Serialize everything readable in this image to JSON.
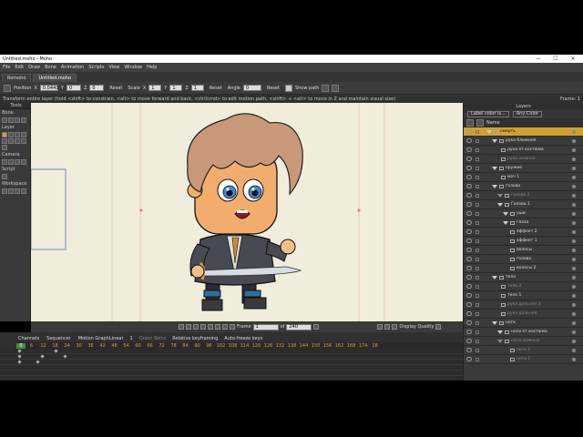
{
  "window": {
    "title": "Untitled.moho - Moho",
    "min": "—",
    "max": "☐",
    "close": "✕"
  },
  "menu": [
    "File",
    "Edit",
    "Draw",
    "Bone",
    "Animation",
    "Scripts",
    "View",
    "Window",
    "Help"
  ],
  "doctabs": [
    "Romoho",
    "Untitled.moho"
  ],
  "options": {
    "position_label": "Position",
    "x_label": "X",
    "x_value": "0.0440",
    "y_label": "Y",
    "y_value": "0",
    "z_label": "Z",
    "z_value": "0",
    "reset1": "Reset",
    "scale_label": "Scale",
    "scale_x_label": "X",
    "scale_x_value": "1",
    "scale_y_label": "Y",
    "scale_y_value": "1",
    "scale_z_label": "Z",
    "scale_z_value": "1",
    "reset2": "Reset",
    "angle_label": "Angle",
    "angle_value": "0",
    "reset3": "Reset",
    "show_path": "Show path"
  },
  "status": {
    "hint": "Transform entire layer (hold <shift> to constrain, <alt> to move forward and back, <ctrl/cmd> to edit motion path, <shift> + <alt> to move in Z and maintain visual size)",
    "frame": "Frame: 1"
  },
  "tools": {
    "header": "Tools",
    "bone": "Bone",
    "layer": "Layer",
    "camera": "Camera",
    "script": "Script",
    "workspace": "Workspace"
  },
  "playback": {
    "frame_label": "Frame",
    "frame_value": "1",
    "of_label": "of",
    "of_value": "240",
    "display_quality": "Display Quality"
  },
  "timeline": {
    "tabs": [
      "Channels",
      "Sequencer",
      "Motion Graph"
    ],
    "interp": "Linear",
    "interp_num": "1",
    "onion": "Onion Skins",
    "relative": "Relative keyframing",
    "autofreeze": "Auto-freeze keys",
    "ruler": [
      "6",
      "12",
      "18",
      "24",
      "30",
      "36",
      "42",
      "48",
      "54",
      "60",
      "66",
      "72",
      "78",
      "84",
      "90",
      "96",
      "102",
      "108",
      "114",
      "120",
      "126",
      "132",
      "138",
      "144",
      "150",
      "156",
      "162",
      "168",
      "174",
      "18"
    ],
    "ruler_first": "0"
  },
  "layers": {
    "header": "Layers",
    "filter1": "Label color is...",
    "filter2": "Any Color",
    "col_name": "Name",
    "rows": [
      {
        "name": "смерть",
        "sel": true,
        "indent": 0
      },
      {
        "name": "рука ближняя",
        "indent": 1
      },
      {
        "name": "рука от костюма",
        "indent": 2
      },
      {
        "name": "рука ножная",
        "indent": 2,
        "dim": true
      },
      {
        "name": "оружие",
        "indent": 1
      },
      {
        "name": "меч 1",
        "indent": 2
      },
      {
        "name": "голова",
        "indent": 1
      },
      {
        "name": "голова 2",
        "indent": 2,
        "dim": true
      },
      {
        "name": "Голова 1",
        "indent": 2
      },
      {
        "name": "уши",
        "indent": 3
      },
      {
        "name": "глаза",
        "indent": 3
      },
      {
        "name": "эффект 2",
        "indent": 3
      },
      {
        "name": "эффект 1",
        "indent": 3
      },
      {
        "name": "волосы",
        "indent": 3
      },
      {
        "name": "голова",
        "indent": 3
      },
      {
        "name": "волосы 2",
        "indent": 3
      },
      {
        "name": "тело",
        "indent": 1
      },
      {
        "name": "тело 2",
        "indent": 2,
        "dim": true
      },
      {
        "name": "тело 1",
        "indent": 2
      },
      {
        "name": "рука дальняя 3",
        "indent": 2,
        "dim": true
      },
      {
        "name": "рука дальняя",
        "indent": 2,
        "dim": true
      },
      {
        "name": "ноги",
        "indent": 1
      },
      {
        "name": "ноги от костюма",
        "indent": 2
      },
      {
        "name": "ноги ножные",
        "indent": 2,
        "dim": true
      },
      {
        "name": "нога 2",
        "indent": 3,
        "dim": true
      },
      {
        "name": "нога 1",
        "indent": 3,
        "dim": true
      }
    ]
  }
}
